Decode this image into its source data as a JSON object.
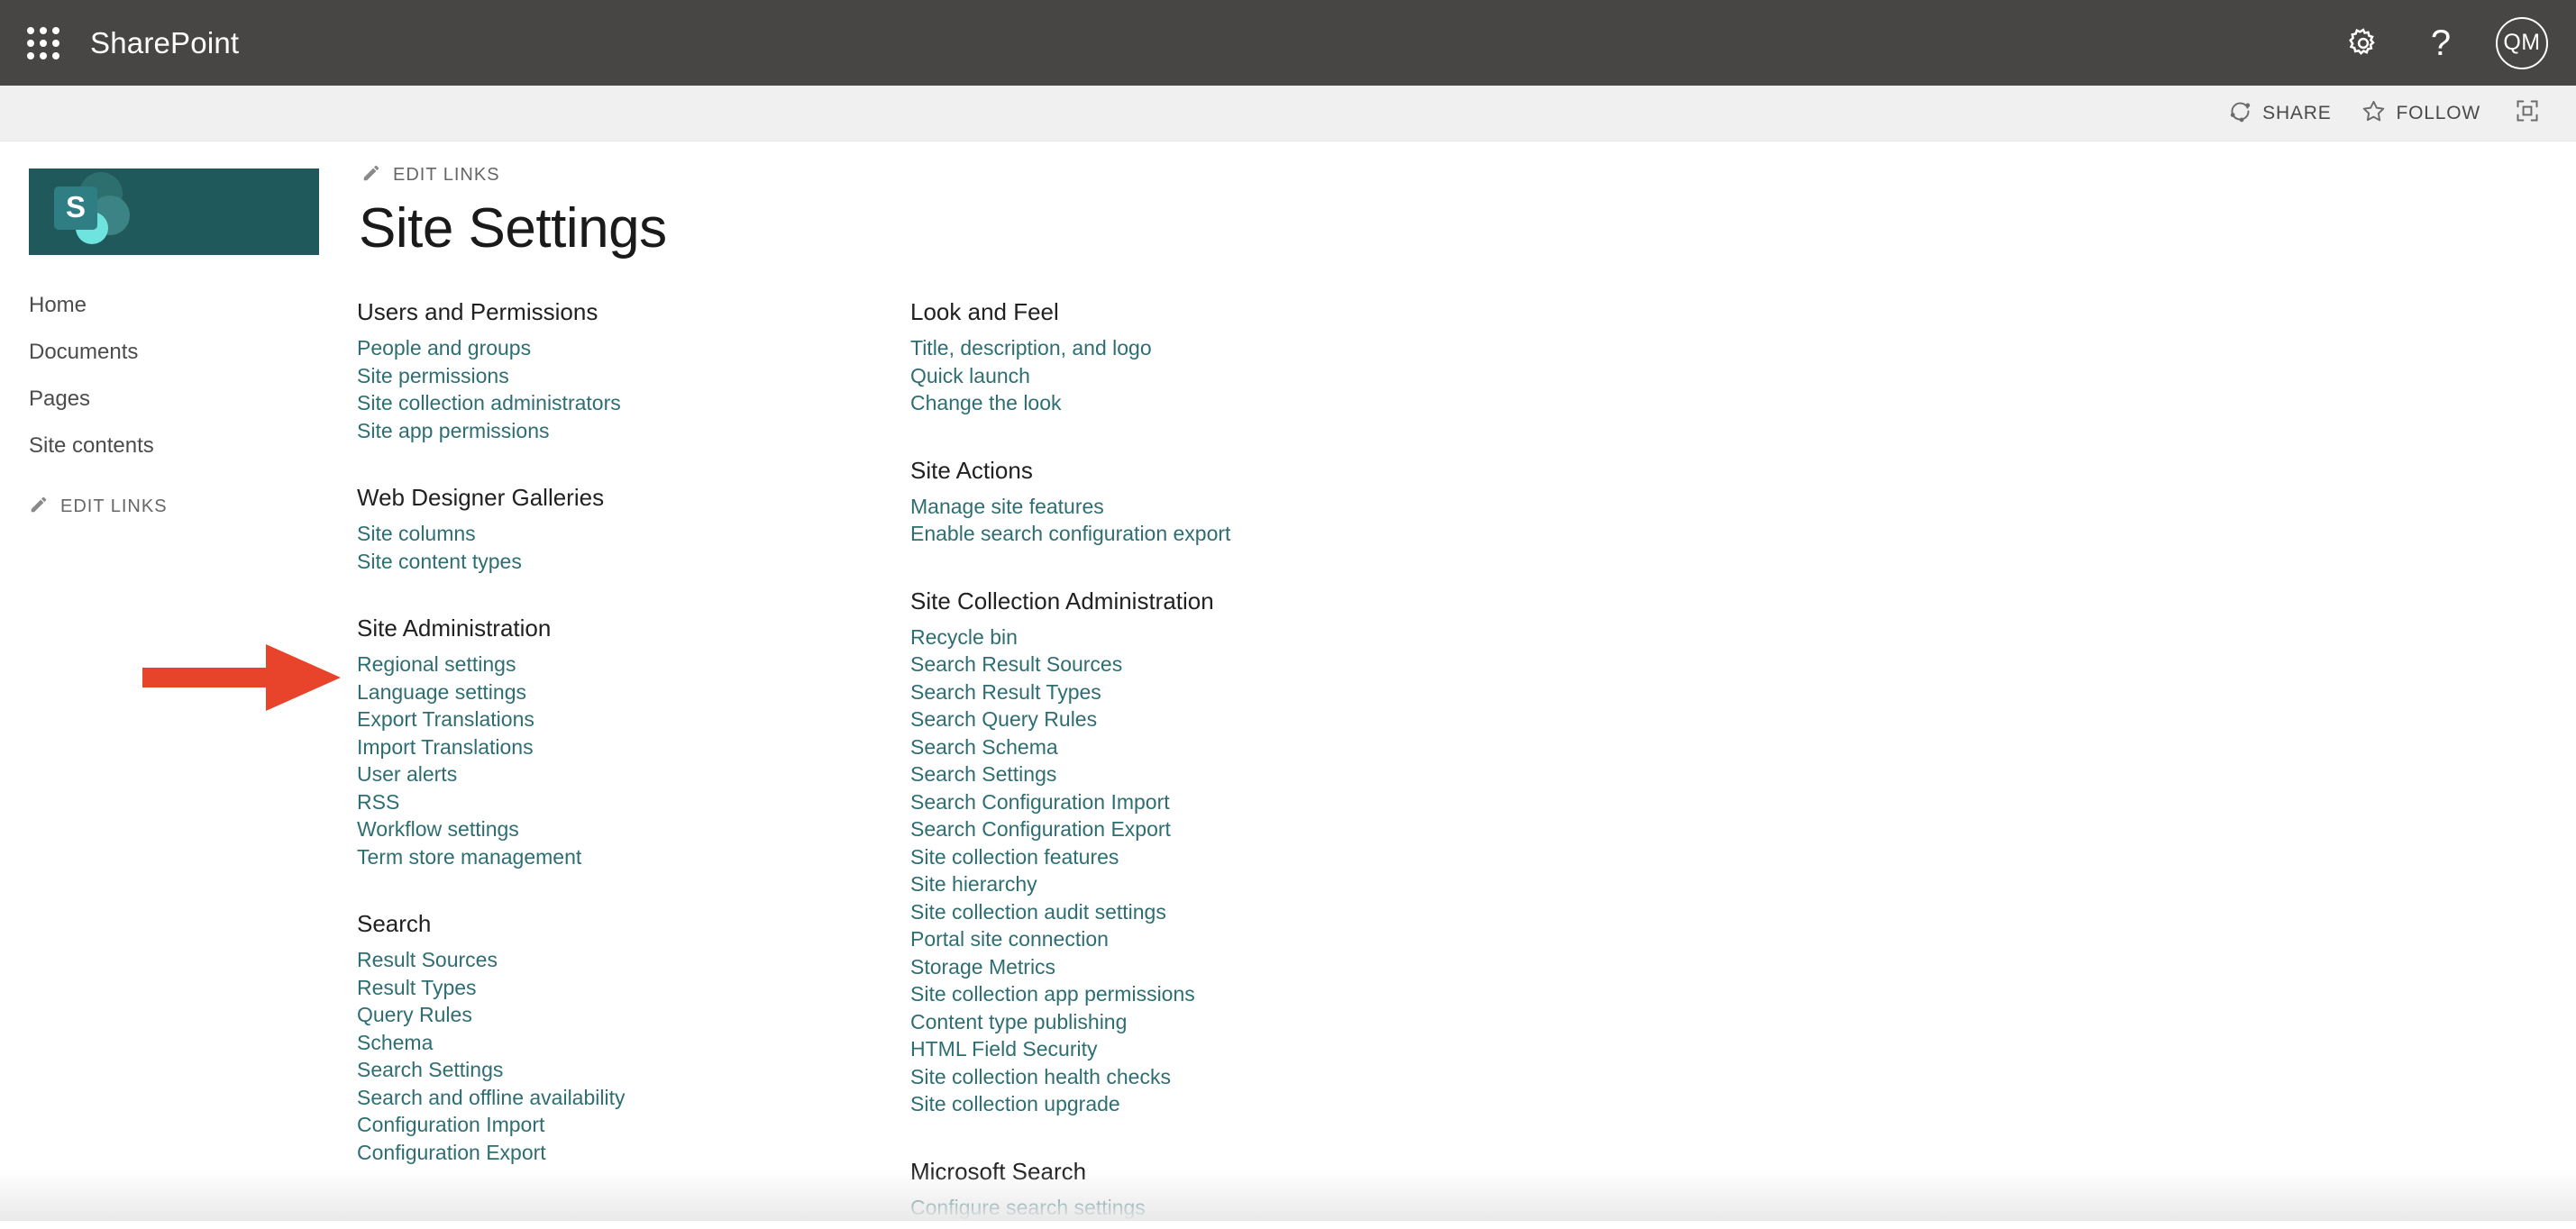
{
  "suite": {
    "waffle_label": "App launcher",
    "brand": "SharePoint",
    "settings_icon": "gear-icon",
    "help_icon": "question-mark-icon",
    "help_glyph": "?",
    "avatar_initials": "QM"
  },
  "command_bar": {
    "share": {
      "label": "SHARE",
      "icon": "share-icon"
    },
    "follow": {
      "label": "FOLLOW",
      "icon": "star-icon"
    },
    "focus": {
      "icon": "focus-on-content-icon"
    }
  },
  "site": {
    "logo_icon": "sharepoint-logo",
    "logo_bg": "#20595b",
    "edit_links_label": "EDIT LINKS",
    "nav": [
      {
        "label": "Home"
      },
      {
        "label": "Documents"
      },
      {
        "label": "Pages"
      },
      {
        "label": "Site contents"
      }
    ]
  },
  "main": {
    "edit_links_label": "EDIT LINKS",
    "title": "Site Settings"
  },
  "colors": {
    "link": "#2e6e72",
    "heading": "#212121",
    "suite_bar": "#484644",
    "command_bar": "#f0f0f0",
    "annotation_arrow": "#e8432b"
  },
  "annotation": {
    "arrow_icon": "red-arrow-pointing-right",
    "points_at": "Site columns"
  },
  "columns": [
    {
      "groups": [
        {
          "title": "Users and Permissions",
          "links": [
            "People and groups",
            "Site permissions",
            "Site collection administrators",
            "Site app permissions"
          ]
        },
        {
          "title": "Web Designer Galleries",
          "links": [
            "Site columns",
            "Site content types"
          ]
        },
        {
          "title": "Site Administration",
          "links": [
            "Regional settings",
            "Language settings",
            "Export Translations",
            "Import Translations",
            "User alerts",
            "RSS",
            "Workflow settings",
            "Term store management"
          ]
        },
        {
          "title": "Search",
          "links": [
            "Result Sources",
            "Result Types",
            "Query Rules",
            "Schema",
            "Search Settings",
            "Search and offline availability",
            "Configuration Import",
            "Configuration Export"
          ]
        }
      ]
    },
    {
      "groups": [
        {
          "title": "Look and Feel",
          "links": [
            "Title, description, and logo",
            "Quick launch",
            "Change the look"
          ]
        },
        {
          "title": "Site Actions",
          "links": [
            "Manage site features",
            "Enable search configuration export"
          ]
        },
        {
          "title": "Site Collection Administration",
          "links": [
            "Recycle bin",
            "Search Result Sources",
            "Search Result Types",
            "Search Query Rules",
            "Search Schema",
            "Search Settings",
            "Search Configuration Import",
            "Search Configuration Export",
            "Site collection features",
            "Site hierarchy",
            "Site collection audit settings",
            "Portal site connection",
            "Storage Metrics",
            "Site collection app permissions",
            "Content type publishing",
            "HTML Field Security",
            "Site collection health checks",
            "Site collection upgrade"
          ]
        },
        {
          "title": "Microsoft Search",
          "links": [
            "Configure search settings"
          ]
        }
      ]
    }
  ]
}
